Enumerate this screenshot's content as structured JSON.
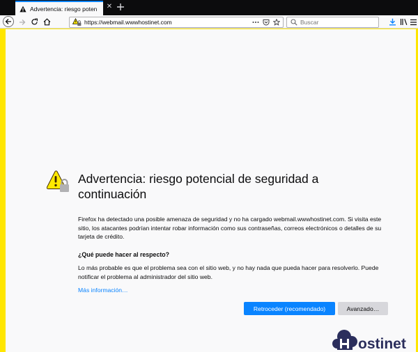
{
  "browser": {
    "tab": {
      "title": "Advertencia: riesgo potencial d",
      "close_symbol": "✕"
    },
    "new_tab_symbol": "+",
    "url": "https://webmail.wwwhostinet.com",
    "search_placeholder": "Buscar",
    "icons": {
      "back": "back-arrow-icon",
      "forward": "forward-arrow-icon",
      "reload": "reload-icon",
      "home": "home-icon",
      "page_actions": "more-dots-icon",
      "pocket": "pocket-icon",
      "bookmark": "star-icon",
      "downloads": "download-icon",
      "library": "library-icon",
      "menu": "hamburger-menu-icon"
    }
  },
  "warning_page": {
    "title": "Advertencia: riesgo potencial de seguridad a continuación",
    "intro": "Firefox ha detectado una posible amenaza de seguridad y no ha cargado webmail.wwwhostinet.com. Si visita este sitio, los atacantes podrían intentar robar información como sus contraseñas, correos electrónicos o detalles de su tarjeta de crédito.",
    "what_heading": "¿Qué puede hacer al respecto?",
    "what_text": "Lo más probable es que el problema sea con el sitio web, y no hay nada que pueda hacer para resolverlo. Puede notificar el problema al administrador del sitio web.",
    "learn_more": "Más información…",
    "go_back_button": "Retroceder (recomendado)",
    "advanced_button": "Avanzado…"
  },
  "watermark": {
    "brand": "Hostinet"
  },
  "colors": {
    "frame_highlight": "#ffe600",
    "accent_blue": "#0a84ff",
    "warning_yellow": "#ffe900",
    "tab_bar": "#0c0c0d"
  }
}
